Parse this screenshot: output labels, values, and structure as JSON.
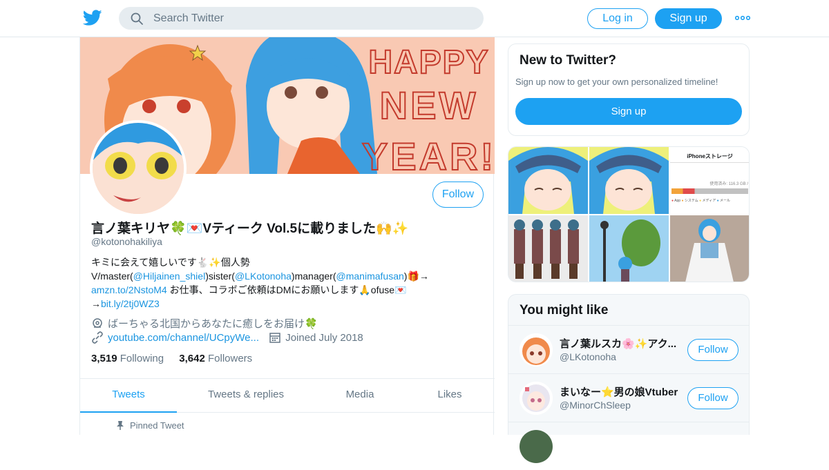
{
  "header": {
    "search_placeholder": "Search Twitter",
    "login_label": "Log in",
    "signup_label": "Sign up",
    "accent": "#1da1f2"
  },
  "banner": {
    "text_lines": [
      "HAPPY",
      "NEW",
      "YEAR!"
    ]
  },
  "profile": {
    "follow_label": "Follow",
    "name": "言ノ葉キリヤ🍀💌Vティーク Vol.5に載りました🙌✨",
    "handle": "@kotonohakiliya",
    "bio_line1": "キミに会えて嬉しいです🐇✨個人勢",
    "bio_line2_a": "V/master(",
    "bio_line2_link1": "@Hiljainen_shiel",
    "bio_line2_b": ")sister(",
    "bio_line2_link2": "@LKotonoha",
    "bio_line2_c": ")manager(",
    "bio_line2_link3": "@manimafusan",
    "bio_line2_d": ")🎁→",
    "bio_line3_link": "amzn.to/2NstoM4",
    "bio_line3_text": " お仕事、コラボご依頼はDMにお願いします🙏ofuse💌",
    "bio_line4_prefix": "→",
    "bio_line4_link": "bit.ly/2tj0WZ3",
    "location": "ばーちゃる北国からあなたに癒しをお届け🍀",
    "website": "youtube.com/channel/UCpyWe...",
    "joined": "Joined July 2018",
    "following_count": "3,519",
    "following_label": "Following",
    "followers_count": "3,642",
    "followers_label": "Followers"
  },
  "tabs": [
    {
      "label": "Tweets",
      "active": true
    },
    {
      "label": "Tweets & replies",
      "active": false
    },
    {
      "label": "Media",
      "active": false
    },
    {
      "label": "Likes",
      "active": false
    }
  ],
  "pinned_label": "Pinned Tweet",
  "new_to_twitter": {
    "title": "New to Twitter?",
    "subtitle": "Sign up now to get your own personalized timeline!",
    "button": "Sign up"
  },
  "media_grid": {
    "storage_title": "iPhoneストレージ",
    "storage_used": "使用済み: 116.3 GB /",
    "storage_legend": [
      "App",
      "システム",
      "メディア",
      "メール"
    ]
  },
  "you_might_like": {
    "title": "You might like",
    "items": [
      {
        "name": "言ノ葉ルスカ🌸✨アク...",
        "handle": "@LKotonoha",
        "follow": "Follow"
      },
      {
        "name": "まいなー⭐男の娘Vtuber",
        "handle": "@MinorChSleep",
        "follow": "Follow"
      }
    ]
  }
}
